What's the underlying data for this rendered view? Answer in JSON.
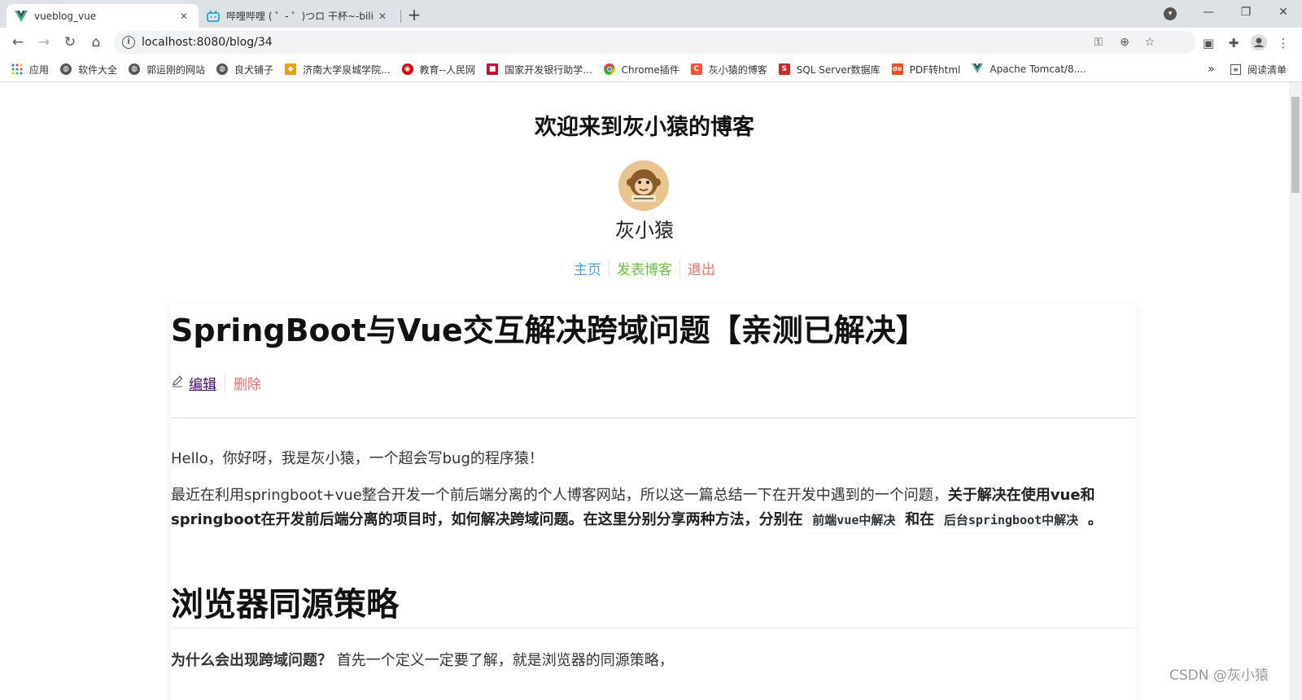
{
  "browser": {
    "tabs": [
      {
        "title": "vueblog_vue",
        "favicon": "vue-logo-icon",
        "active": true
      },
      {
        "title": "哔哩哔哩 ( ゜- ゜)つロ 干杯~-bili",
        "favicon": "bilibili-icon",
        "active": false
      }
    ],
    "url": "localhost:8080/blog/34",
    "bookmarks": [
      {
        "label": "应用",
        "icon": "apps-grid-icon"
      },
      {
        "label": "软件大全",
        "icon": "globe-icon"
      },
      {
        "label": "郭运刚的网站",
        "icon": "globe-icon"
      },
      {
        "label": "良犬铺子",
        "icon": "globe-icon"
      },
      {
        "label": "济南大学泉城学院...",
        "icon": "school-icon"
      },
      {
        "label": "教育--人民网",
        "icon": "people-daily-icon"
      },
      {
        "label": "国家开发银行助学...",
        "icon": "bank-icon"
      },
      {
        "label": "Chrome插件",
        "icon": "chrome-icon"
      },
      {
        "label": "灰小猿的博客",
        "icon": "csdn-icon"
      },
      {
        "label": "SQL Server数据库",
        "icon": "sqlserver-icon"
      },
      {
        "label": "PDF转html",
        "icon": "pdf-icon"
      },
      {
        "label": "Apache Tomcat/8....",
        "icon": "vue-logo-icon"
      }
    ],
    "reading_list": "阅读清单",
    "more_bookmarks": "»"
  },
  "site": {
    "title": "欢迎来到灰小猿的博客",
    "username": "灰小猿",
    "nav": {
      "home": "主页",
      "post": "发表博客",
      "logout": "退出"
    },
    "colors": {
      "home": "#409eff",
      "post": "#67c23a",
      "logout": "#f56c6c"
    }
  },
  "post": {
    "title": "SpringBoot与Vue交互解决跨域问题【亲测已解决】",
    "edit": "编辑",
    "delete": "删除",
    "p1": "Hello，你好呀，我是灰小猿，一个超会写bug的程序猿！",
    "p2_plain": "最近在利用springboot+vue整合开发一个前后端分离的个人博客网站，所以这一篇总结一下在开发中遇到的一个问题，",
    "p2_bold1": "关于解决在使用vue和springboot在开发前后端分离的项目时，如何解决跨域问题。在这里分别分享两种方法，分别在",
    "p2_code1": "前端vue中解决",
    "p2_bold2": "和在",
    "p2_code2": "后台springboot中解决",
    "p2_end": "。",
    "h2": "浏览器同源策略",
    "p3_bold": "为什么会出现跨域问题？",
    "p3_plain": " 首先一个定义一定要了解，就是浏览器的同源策略，"
  },
  "watermark": "CSDN @灰小猿"
}
